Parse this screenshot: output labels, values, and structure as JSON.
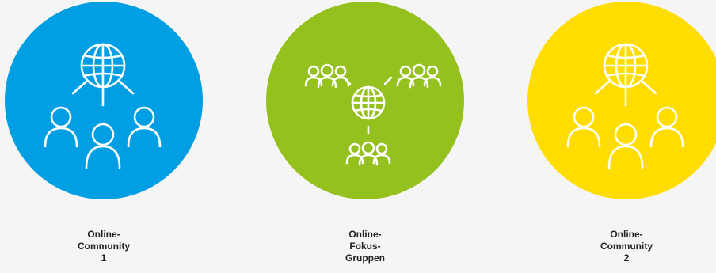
{
  "items": [
    {
      "label_lines": [
        "Online-",
        "Community",
        "1"
      ],
      "color": "#009fe3",
      "icon": "globe-with-people-icon"
    },
    {
      "label_lines": [
        "Online-",
        "Fokus-",
        "Gruppen"
      ],
      "color": "#95c11f",
      "icon": "globe-connected-groups-icon"
    },
    {
      "label_lines": [
        "Online-",
        "Community",
        "2"
      ],
      "color": "#ffdd00",
      "icon": "globe-with-people-icon"
    }
  ]
}
